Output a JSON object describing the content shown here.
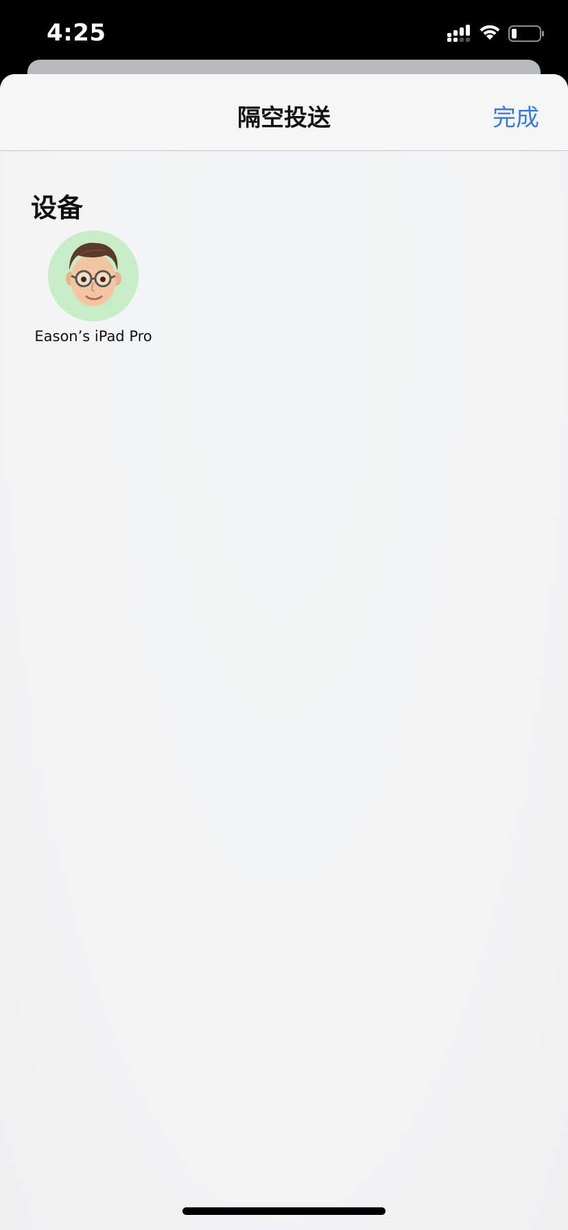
{
  "status_bar": {
    "time": "4:25"
  },
  "sheet": {
    "title": "隔空投送",
    "done_label": "完成"
  },
  "devices_section": {
    "header": "设备",
    "devices": [
      {
        "name": "Eason’s iPad Pro",
        "avatar": "memoji-avatar"
      }
    ]
  },
  "colors": {
    "accent": "#3a7bd5",
    "avatar_bg": "#c8ebc8"
  }
}
